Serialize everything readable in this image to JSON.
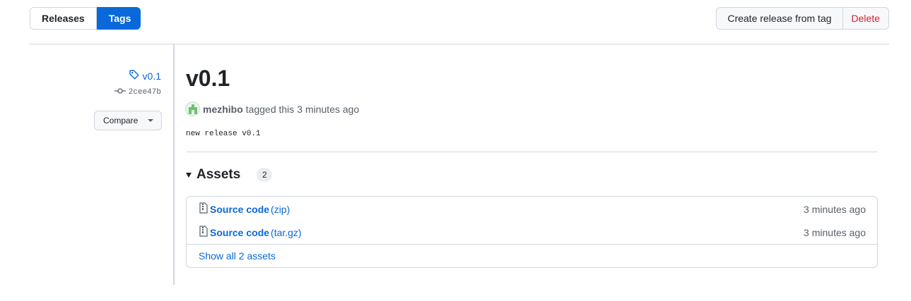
{
  "toggle": {
    "releases": "Releases",
    "tags": "Tags"
  },
  "actions": {
    "create": "Create release from tag",
    "delete": "Delete"
  },
  "sidebar": {
    "tag_name": "v0.1",
    "commit": "2cee47b",
    "compare": "Compare",
    "tag_icon": "tag-icon",
    "commit_icon": "git-commit-icon"
  },
  "release": {
    "title": "v0.1",
    "author": "mezhibo",
    "tagged_text": "tagged this",
    "time": "3 minutes ago",
    "body": "new release v0.1"
  },
  "assets": {
    "heading": "Assets",
    "count": "2",
    "items": [
      {
        "name": "Source code",
        "ext": "(zip)",
        "time": "3 minutes ago",
        "icon": "file-zip-icon"
      },
      {
        "name": "Source code",
        "ext": "(tar.gz)",
        "time": "3 minutes ago",
        "icon": "file-zip-icon"
      }
    ],
    "show_all": "Show all 2 assets"
  },
  "colors": {
    "accent": "#0969da",
    "danger": "#cf222e",
    "border": "#d0d7de",
    "muted": "#57606a"
  }
}
